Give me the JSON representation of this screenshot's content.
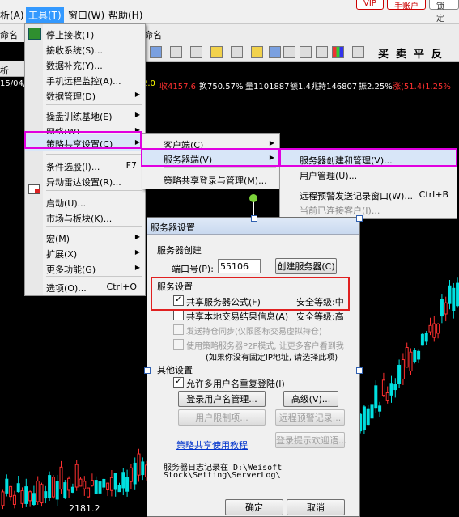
{
  "menubar": {
    "items": [
      "析(A)",
      "工具(T)",
      "窗口(W)",
      "帮助(H)"
    ],
    "right_buttons": [
      "VIP",
      "手账户",
      "锁定"
    ]
  },
  "toolbar": {
    "row2_labels": [
      "命名",
      "命名"
    ],
    "chars": [
      "买",
      "卖",
      "平",
      "反"
    ]
  },
  "tabs": {
    "left_tab": "析"
  },
  "stats": {
    "date": "15/04/",
    "pct_tail": "2.0",
    "shou": "收4157.6",
    "huan": "换750.57%",
    "liang": "量1101887",
    "e": "额1.4兆",
    "chi": "持146807",
    "zhen": "振2.25%",
    "zhang": "涨(51.4)1.25%"
  },
  "tools_menu": {
    "items": [
      {
        "label": "停止接收(T)",
        "shortcut": "",
        "arrow": false
      },
      {
        "label": "接收系统(S)...",
        "shortcut": "",
        "arrow": false
      },
      {
        "label": "数据补充(Y)...",
        "shortcut": "",
        "arrow": false
      },
      {
        "label": "手机远程监控(A)...",
        "shortcut": "",
        "arrow": false
      },
      {
        "label": "数据管理(D)",
        "shortcut": "",
        "arrow": true
      },
      {
        "label": "操盘训练基地(E)",
        "shortcut": "",
        "arrow": true
      },
      {
        "label": "网络(W)",
        "shortcut": "",
        "arrow": true
      },
      {
        "label": "策略共享设置(C)",
        "shortcut": "",
        "arrow": true
      },
      {
        "label": "条件选股(I)...",
        "shortcut": "F7",
        "arrow": false
      },
      {
        "label": "异动雷达设置(R)...",
        "shortcut": "",
        "arrow": false
      },
      {
        "label": "启动(U)...",
        "shortcut": "",
        "arrow": false
      },
      {
        "label": "市场与板块(K)...",
        "shortcut": "",
        "arrow": false
      },
      {
        "label": "宏(M)",
        "shortcut": "",
        "arrow": true
      },
      {
        "label": "扩展(X)",
        "shortcut": "",
        "arrow": true
      },
      {
        "label": "更多功能(G)",
        "shortcut": "",
        "arrow": true
      },
      {
        "label": "选项(O)...",
        "shortcut": "Ctrl+O",
        "arrow": false
      }
    ]
  },
  "strategy_submenu": {
    "items": [
      {
        "label": "客户端(C)",
        "arrow": true
      },
      {
        "label": "服务器端(V)",
        "arrow": true
      },
      {
        "label": "策略共享登录与管理(M)...",
        "arrow": false
      }
    ]
  },
  "server_submenu": {
    "items": [
      {
        "label": "服务器创建和管理(V)...",
        "shortcut": ""
      },
      {
        "label": "用户管理(U)...",
        "shortcut": ""
      },
      {
        "label": "远程预警发送记录窗口(W)...",
        "shortcut": "Ctrl+B"
      },
      {
        "label": "当前已连接客户(I)...",
        "shortcut": ""
      }
    ]
  },
  "dialog": {
    "title": "服务器设置",
    "group_create": "服务器创建",
    "port_label": "端口号(P):",
    "port_value": "55106",
    "create_btn": "创建服务器(C)",
    "group_service": "服务设置",
    "share_formula": "共享服务器公式(F)",
    "share_formula_level": "安全等级:中",
    "share_local": "共享本地交易结果信息(A)",
    "share_local_level": "安全等级:高",
    "send_hold": "发送持仓同步(仅限图标交易虚拟持仓)",
    "p2p_line1": "使用策略服务器P2P模式, 让更多客户看到我",
    "p2p_line2": "(如果你没有固定IP地址, 请选择此项)",
    "group_other": "其他设置",
    "allow_multi": "允许多用户名重复登陆(I)",
    "login_mgr_btn": "登录用户名管理...",
    "advanced_btn": "高级(V)...",
    "user_limit_btn": "用户限制项...",
    "remote_alert_btn": "远程预警记录...",
    "tutorial_link": "策略共享使用教程",
    "login_tip_btn": "登录提示欢迎语...",
    "log_line1": "服务器日志记录在 D:\\Weisoft",
    "log_line2": "Stock\\Setting\\ServerLog\\",
    "ok_btn": "确定",
    "cancel_btn": "取消"
  },
  "chart_label": "2181.2",
  "colors": {
    "magenta_highlight": "#e000e0",
    "red_highlight": "#e02020",
    "bull_red": "#ff3030",
    "bear_cyan": "#00e0e0"
  }
}
